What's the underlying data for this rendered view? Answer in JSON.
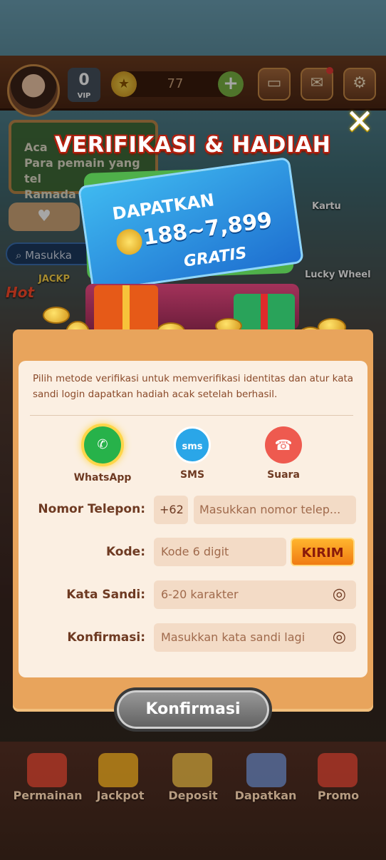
{
  "header": {
    "coins": "77",
    "vip_level": "0",
    "vip_label": "VIP"
  },
  "background": {
    "announcement_line1": "Aca",
    "announcement_line2": "Para pemain yang tel",
    "announcement_line3": "Ramada",
    "search_placeholder": "Masukka",
    "side_items": [
      "Kartu",
      "Lucky Wheel"
    ],
    "jackpot_label": "JACKP",
    "hot_label": "Hot"
  },
  "dialog": {
    "title": "VERIFIKASI & HADIAH",
    "card_line1": "DAPATKAN",
    "card_amount": "188~7,899",
    "card_line3": "GRATIS",
    "description": "Pilih metode verifikasi untuk memverifikasi identitas dan atur kata sandi login dapatkan hadiah acak setelah berhasil.",
    "methods": [
      {
        "label": "WhatsApp",
        "icon": "whatsapp-icon",
        "selected": true
      },
      {
        "label": "SMS",
        "icon": "sms-icon",
        "selected": false
      },
      {
        "label": "Suara",
        "icon": "phone-voice-icon",
        "selected": false
      }
    ],
    "phone_label": "Nomor Telepon:",
    "country_code": "+62",
    "phone_placeholder": "Masukkan nomor telep...",
    "code_label": "Kode:",
    "code_placeholder": "Kode 6 digit",
    "send_button": "KIRIM",
    "password_label": "Kata Sandi:",
    "password_placeholder": "6-20 karakter",
    "confirm_label": "Konfirmasi:",
    "confirm_placeholder": "Masukkan kata sandi lagi",
    "confirm_button": "Konfirmasi"
  },
  "bottom_nav": [
    "Permainan",
    "Jackpot",
    "Deposit",
    "Dapatkan",
    "Promo"
  ],
  "colors": {
    "accent_orange": "#f07b12",
    "panel": "#e8a45c",
    "whatsapp": "#27b24a",
    "sms": "#2aa6e8",
    "voice": "#ee5a4f"
  }
}
